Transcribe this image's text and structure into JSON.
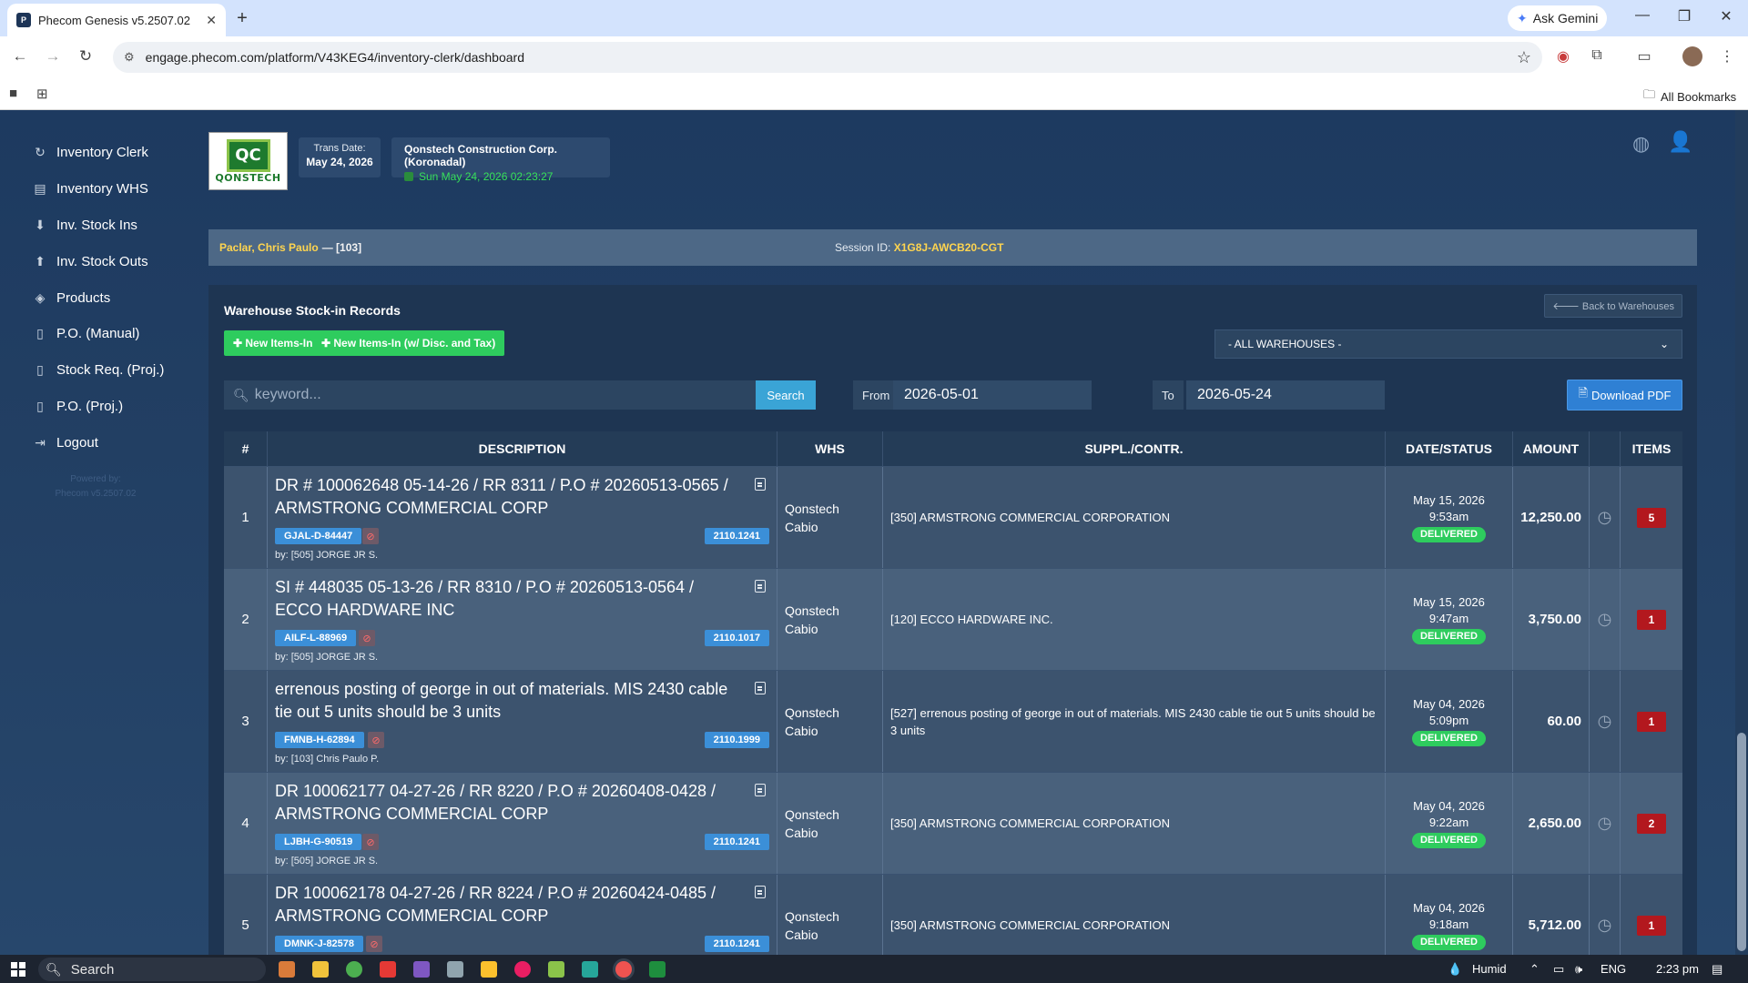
{
  "browser": {
    "tab_title": "Phecom Genesis v5.2507.02",
    "url": "engage.phecom.com/platform/V43KEG4/inventory-clerk/dashboard",
    "gemini_label": "Ask Gemini",
    "all_bookmarks": "All Bookmarks"
  },
  "sidebar": {
    "items": [
      {
        "label": "Inventory Clerk",
        "icon": "refresh-icon"
      },
      {
        "label": "Inventory WHS",
        "icon": "warehouse-icon"
      },
      {
        "label": "Inv. Stock Ins",
        "icon": "arrow-down-circle-icon"
      },
      {
        "label": "Inv. Stock Outs",
        "icon": "arrow-up-circle-icon"
      },
      {
        "label": "Products",
        "icon": "cube-icon"
      },
      {
        "label": "P.O. (Manual)",
        "icon": "document-icon"
      },
      {
        "label": "Stock Req. (Proj.)",
        "icon": "document-icon"
      },
      {
        "label": "P.O. (Proj.)",
        "icon": "document-icon"
      },
      {
        "label": "Logout",
        "icon": "logout-icon"
      }
    ],
    "powered_by": "Powered by:",
    "version": "Phecom v5.2507.02"
  },
  "header": {
    "logo_text": "QONSTECH",
    "logo_mark": "QC",
    "trans_date_label": "Trans Date:",
    "trans_date_value": "May 24, 2026",
    "company_name": "Qonstech Construction Corp. (Koronadal)",
    "company_time": "Sun May 24, 2026 02:23:27"
  },
  "userbar": {
    "user_name": "Paclar, Chris Paulo",
    "user_code": "— [103]",
    "session_label": "Session ID:",
    "session_id": "X1G8J-AWCB20-CGT"
  },
  "panel": {
    "title": "Warehouse Stock-in Records",
    "back_label": "Back to Warehouses",
    "new_items_label": "New Items-In",
    "new_items_disc_label": "New Items-In (w/ Disc. and Tax)",
    "warehouse_select": "- ALL WAREHOUSES -",
    "search_placeholder": "keyword...",
    "search_button": "Search",
    "from_label": "From",
    "from_value": "2026-05-01",
    "to_label": "To",
    "to_value": "2026-05-24",
    "download_pdf": "Download PDF"
  },
  "table": {
    "headers": [
      "#",
      "DESCRIPTION",
      "WHS",
      "SUPPL./CONTR.",
      "DATE/STATUS",
      "AMOUNT",
      "ITEMS"
    ],
    "rows": [
      {
        "num": "1",
        "desc": "DR # 100062648 05-14-26 / RR 8311 / P.O # 20260513-0565 / ARMSTRONG COMMERCIAL CORP",
        "code": "GJAL-D-84447",
        "acct": "2110.1241",
        "by": "by: [505] JORGE JR S.",
        "whs": "Qonstech Cabio",
        "supplier": "[350] ARMSTRONG COMMERCIAL CORPORATION",
        "date": "May 15, 2026",
        "time": "9:53am",
        "status": "DELIVERED",
        "amount": "12,250.00",
        "items": "5"
      },
      {
        "num": "2",
        "desc": "SI # 448035 05-13-26 / RR 8310 / P.O # 20260513-0564 / ECCO HARDWARE INC",
        "code": "AILF-L-88969",
        "acct": "2110.1017",
        "by": "by: [505] JORGE JR S.",
        "whs": "Qonstech Cabio",
        "supplier": "[120] ECCO HARDWARE INC.",
        "date": "May 15, 2026",
        "time": "9:47am",
        "status": "DELIVERED",
        "amount": "3,750.00",
        "items": "1"
      },
      {
        "num": "3",
        "desc": "errenous posting of george in out of materials. MIS 2430 cable tie out 5 units should be 3 units",
        "code": "FMNB-H-62894",
        "acct": "2110.1999",
        "by": "by: [103] Chris Paulo P.",
        "whs": "Qonstech Cabio",
        "supplier": "[527] errenous posting of george in out of materials. MIS 2430 cable tie out 5 units should be 3 units",
        "date": "May 04, 2026",
        "time": "5:09pm",
        "status": "DELIVERED",
        "amount": "60.00",
        "items": "1"
      },
      {
        "num": "4",
        "desc": "DR 100062177 04-27-26 / RR 8220 / P.O # 20260408-0428 / ARMSTRONG COMMERCIAL CORP",
        "code": "LJBH-G-90519",
        "acct": "2110.1241",
        "by": "by: [505] JORGE JR S.",
        "whs": "Qonstech Cabio",
        "supplier": "[350] ARMSTRONG COMMERCIAL CORPORATION",
        "date": "May 04, 2026",
        "time": "9:22am",
        "status": "DELIVERED",
        "amount": "2,650.00",
        "items": "2"
      },
      {
        "num": "5",
        "desc": "DR 100062178 04-27-26 / RR 8224 / P.O # 20260424-0485 / ARMSTRONG COMMERCIAL CORP",
        "code": "DMNK-J-82578",
        "acct": "2110.1241",
        "by": "",
        "whs": "Qonstech Cabio",
        "supplier": "[350] ARMSTRONG COMMERCIAL CORPORATION",
        "date": "May 04, 2026",
        "time": "9:18am",
        "status": "DELIVERED",
        "amount": "5,712.00",
        "items": "1"
      }
    ]
  },
  "taskbar": {
    "search_label": "Search",
    "weather": "Humid",
    "lang": "ENG",
    "time": "2:23 pm"
  }
}
